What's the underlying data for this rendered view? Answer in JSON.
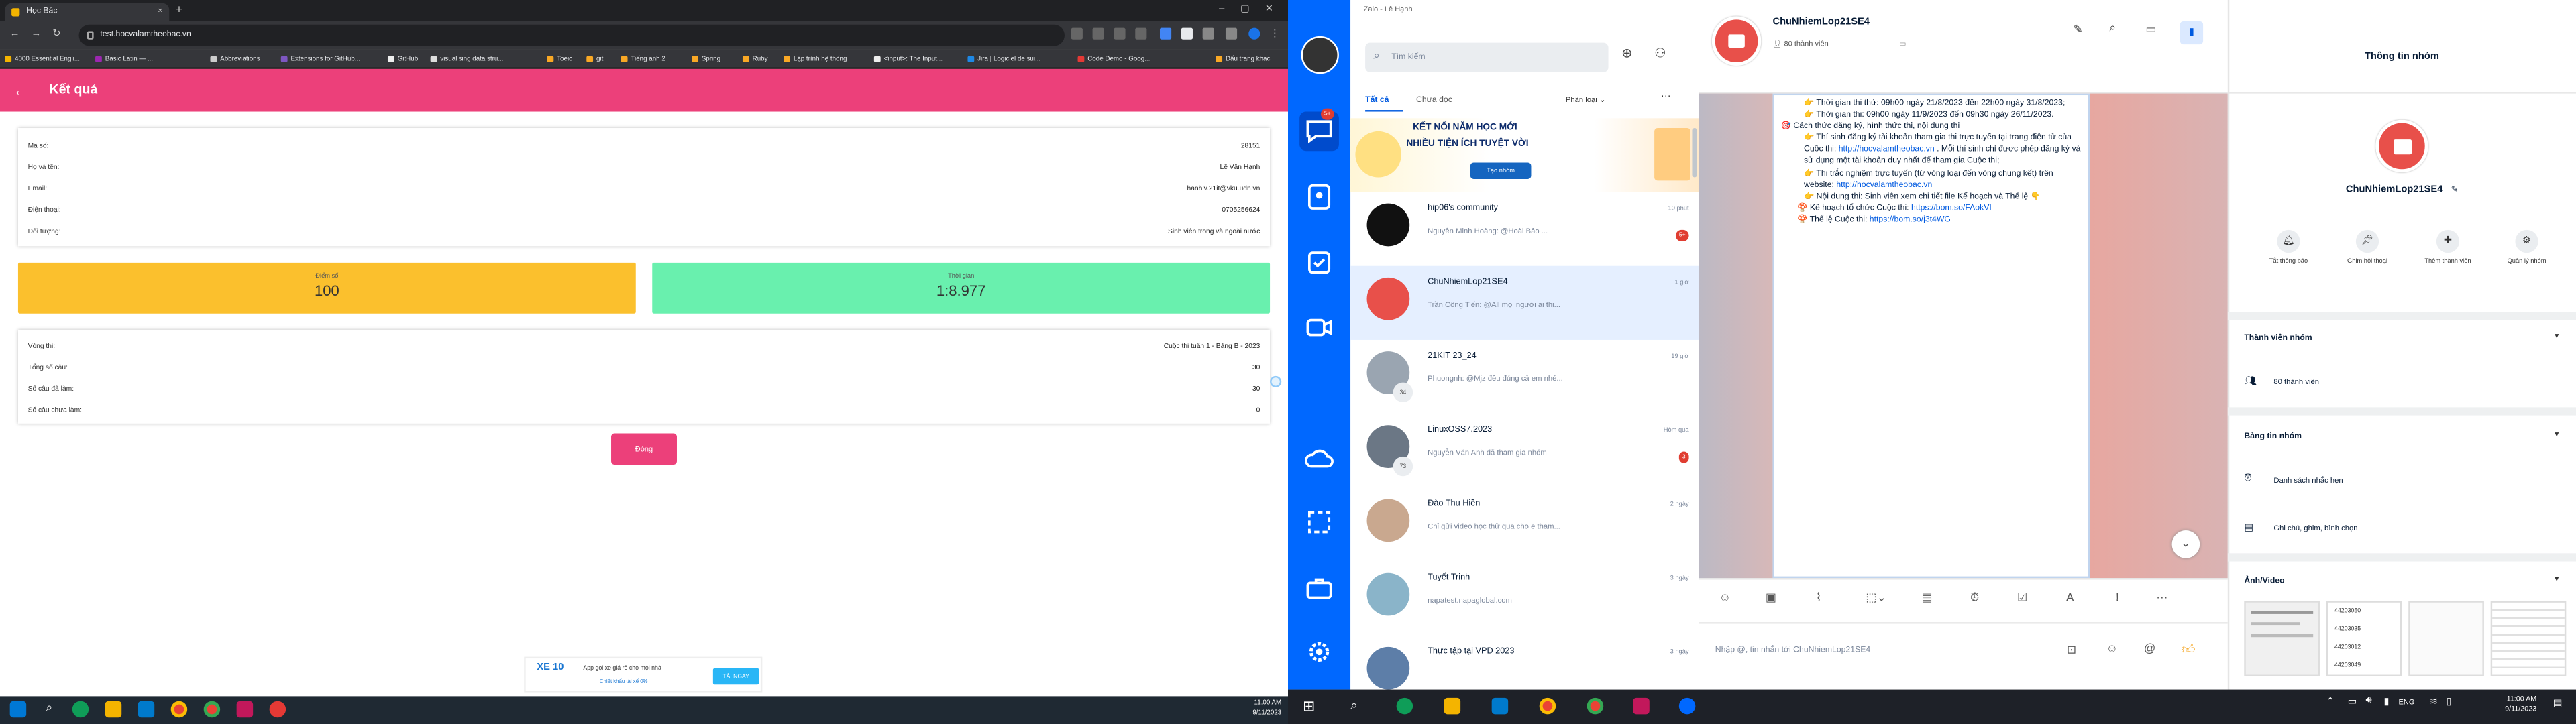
{
  "browser": {
    "tab_title": "Học Bác",
    "url": "test.hocvalamtheobac.vn",
    "bookmarks": [
      "4000 Essential Engli...",
      "Basic Latin — ...",
      "Abbreviations",
      "Extensions for GitHub...",
      "GitHub",
      "visualising data stru...",
      "Toeic",
      "git",
      "Tiếng anh 2",
      "Spring",
      "Ruby",
      "Lập trình hệ thống",
      "<input>: The Input...",
      "Jira | Logiciel de sui...",
      "Code Demo - Goog...",
      "Dấu trang khác"
    ]
  },
  "page": {
    "header_title": "Kết quả",
    "info": [
      {
        "label": "Mã số:",
        "value": "28151"
      },
      {
        "label": "Họ và tên:",
        "value": "Lê Văn Hạnh"
      },
      {
        "label": "Email:",
        "value": "hanhlv.21it@vku.udn.vn"
      },
      {
        "label": "Điện thoại:",
        "value": "0705256624"
      },
      {
        "label": "Đối tượng:",
        "value": "Sinh viên trong và ngoài nước"
      }
    ],
    "score_label": "Điểm số",
    "score_value": "100",
    "time_label": "Thời gian",
    "time_value": "1:8.977",
    "round": [
      {
        "label": "Vòng thi:",
        "value": "Cuộc thi tuần 1 - Bảng B - 2023"
      },
      {
        "label": "Tổng số câu:",
        "value": "30"
      },
      {
        "label": "Số câu đã làm:",
        "value": "30"
      },
      {
        "label": "Số câu chưa làm:",
        "value": "0"
      }
    ],
    "close_button": "Đóng",
    "ad_text_1": "App gọi xe giá rẻ cho mọi nhà",
    "ad_text_2": "Chiết khấu tài xế 0%",
    "ad_button": "TẢI NGAY",
    "ad_logo": "XE 10"
  },
  "left_taskbar": {
    "time": "11:00 AM",
    "date": "9/11/2023"
  },
  "zalo": {
    "window_title": "Zalo - Lê Hạnh",
    "nav_badge": "5+",
    "search_placeholder": "Tìm kiếm",
    "filter_all": "Tất cả",
    "filter_unread": "Chưa đọc",
    "filter_classify": "Phân loại",
    "banner_line1": "KẾT NỐI NĂM HỌC MỚI",
    "banner_line2": "NHIỀU TIỆN ÍCH TUYỆT VỜI",
    "banner_button": "Tạo nhóm",
    "conversations": [
      {
        "name": "hip06's community",
        "preview": "Nguyễn Minh Hoàng: @Hoài Bảo ...",
        "time": "10 phút",
        "badge": "5+",
        "avatar": "#111111"
      },
      {
        "name": "ChuNhiemLop21SE4",
        "preview": "Trần Công Tiến: @All mọi người ai thi...",
        "time": "1 giờ",
        "badge": "",
        "avatar": "#e8504a"
      },
      {
        "name": "21KIT 23_24",
        "preview": "Phuongnh: @Mjz đều đúng cả em nhé...",
        "time": "19 giờ",
        "badge": "",
        "avatar": "#9aa5b1",
        "count": "34"
      },
      {
        "name": "LinuxOSS7.2023",
        "preview": "Nguyễn Văn Anh đã tham gia nhóm",
        "time": "Hôm qua",
        "badge": "3",
        "avatar": "#6b7785",
        "count": "73"
      },
      {
        "name": "Đào Thu Hiền",
        "preview": "Chỉ gửi video học thử qua cho e tham...",
        "time": "2 ngày",
        "badge": "",
        "avatar": "#c9a88f"
      },
      {
        "name": "Tuyết Trinh",
        "preview": "napatest.napaglobal.com",
        "time": "3 ngày",
        "badge": "",
        "avatar": "#8ab4c9"
      },
      {
        "name": "Thực tập tại VPD 2023",
        "preview": "",
        "time": "3 ngày",
        "badge": "",
        "avatar": "#5d7ea8"
      }
    ],
    "chat_title": "ChuNhiemLop21SE4",
    "chat_members": "80 thành viên",
    "message_lines": [
      "👉 Thời gian thi thứ: 09h00 ngày 21/8/2023 đến 22h00 ngày 31/8/2023;",
      "👉 Thời gian thi: 09h00 ngày 11/9/2023 đến 09h30 ngày 26/11/2023.",
      "🎯 Cách thức đăng ký, hình thức thi, nội dung thi",
      "👉 Thí sinh đăng ký tài khoản tham gia thi trực tuyến tại trang điện tử của Cuộc thi: ",
      "http://hocvalamtheobac.vn",
      " . Mỗi thí sinh chỉ được phép đăng ký và sử dụng một tài khoản duy nhất để tham gia Cuộc thi;",
      "👉 Thi trắc nghiệm trực tuyến (từ vòng loại đến vòng chung kết) trên website: ",
      "http://hocvalamtheobac.vn",
      "👉 Nội dung thi: Sinh viên xem chi tiết file Kế hoạch và Thể lệ 👇",
      "🍄 Kế hoạch tổ chức Cuộc thi: ",
      "https://bom.so/FAokVI",
      "🍄 Thể lệ Cuộc thi: ",
      "https://bom.so/j3t4WG"
    ],
    "input_placeholder": "Nhập @, tin nhắn tới ChuNhiemLop21SE4",
    "info_title": "Thông tin nhóm",
    "group_name": "ChuNhiemLop21SE4",
    "actions": [
      "Tắt thông báo",
      "Ghim hội thoại",
      "Thêm thành viên",
      "Quản lý nhóm"
    ],
    "members_section": "Thành viên nhóm",
    "members_count": "80 thành viên",
    "board_section": "Bảng tin nhóm",
    "board_items": [
      "Danh sách nhắc hẹn",
      "Ghi chú, ghim, bình chọn"
    ],
    "media_section": "Ảnh/Video",
    "media_thumb_text": [
      "44203050",
      "44203035",
      "44203012",
      "44203049"
    ]
  },
  "right_taskbar": {
    "time": "11:00 AM",
    "date": "9/11/2023",
    "lang": "ENG"
  },
  "colors": {
    "accent": "#ec407a",
    "score_bg": "#fbc02d",
    "time_bg": "#69f0ae",
    "zalo_blue": "#0068ff"
  }
}
